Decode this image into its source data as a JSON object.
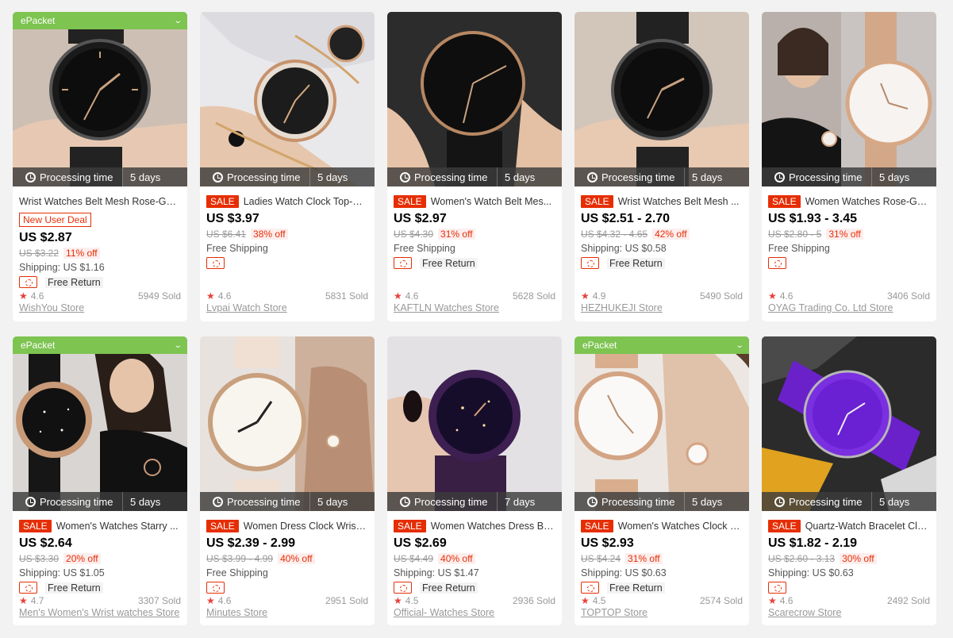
{
  "processing_label": "Processing time",
  "epacket_label": "ePacket",
  "free_return_label": "Free Return",
  "sale_label": "SALE",
  "colors": {
    "sale": "#e62e04",
    "epacket": "#7dc451",
    "star": "#e8403c"
  },
  "products": [
    {
      "epacket": true,
      "days": "5 days",
      "sale": false,
      "title": "Wrist Watches Belt Mesh Rose-Gol...",
      "new_user": "New User Deal",
      "price": "US $2.87",
      "orig": "US $3.22",
      "off": "11% off",
      "shipping": "Shipping: US $1.16",
      "free_return": true,
      "rating": "4.6",
      "sold": "5949 Sold",
      "store": "WishYou Store"
    },
    {
      "epacket": false,
      "days": "5 days",
      "sale": true,
      "title": "Ladies Watch Clock Top-St...",
      "price": "US $3.97",
      "orig": "US $6.41",
      "off": "38% off",
      "shipping": "Free Shipping",
      "free_return": false,
      "rating": "4.6",
      "sold": "5831 Sold",
      "store": "Lvpai Watch Store"
    },
    {
      "epacket": false,
      "days": "5 days",
      "sale": true,
      "title": "Women's Watch Belt Mes...",
      "price": "US $2.97",
      "orig": "US $4.30",
      "off": "31% off",
      "shipping": "Free Shipping",
      "free_return": true,
      "rating": "4.6",
      "sold": "5628 Sold",
      "store": "KAFTLN Watches Store"
    },
    {
      "epacket": false,
      "days": "5 days",
      "sale": true,
      "title": "Wrist Watches Belt Mesh ...",
      "price": "US $2.51 - 2.70",
      "orig": "US $4.32 - 4.65",
      "off": "42% off",
      "shipping": "Shipping: US $0.58",
      "free_return": true,
      "rating": "4.9",
      "sold": "5490 Sold",
      "store": "HEZHUKEJI Store"
    },
    {
      "epacket": false,
      "days": "5 days",
      "sale": true,
      "title": "Women Watches Rose-Gol...",
      "price": "US $1.93 - 3.45",
      "orig": "US $2.80 - 5",
      "off": "31% off",
      "shipping": "Free Shipping",
      "free_return": false,
      "rating": "4.6",
      "sold": "3406 Sold",
      "store": "OYAG Trading Co. Ltd Store"
    },
    {
      "epacket": true,
      "days": "5 days",
      "sale": true,
      "title": "Women's Watches Starry ...",
      "price": "US $2.64",
      "orig": "US $3.30",
      "off": "20% off",
      "shipping": "Shipping: US $1.05",
      "free_return": true,
      "rating": "4.7",
      "sold": "3307 Sold",
      "store": "Men's Women's Wrist watches Store"
    },
    {
      "epacket": false,
      "days": "5 days",
      "sale": true,
      "title": "Women Dress Clock Wrist-...",
      "price": "US $2.39 - 2.99",
      "orig": "US $3.99 - 4.99",
      "off": "40% off",
      "shipping": "Free Shipping",
      "free_return": false,
      "rating": "4.6",
      "sold": "2951 Sold",
      "store": "Minutes Store"
    },
    {
      "epacket": false,
      "days": "7 days",
      "sale": true,
      "title": "Women Watches Dress Be...",
      "price": "US $2.69",
      "orig": "US $4.49",
      "off": "40% off",
      "shipping": "Shipping: US $1.47",
      "free_return": true,
      "rating": "4.5",
      "sold": "2936 Sold",
      "store": "Official- Watches Store"
    },
    {
      "epacket": true,
      "days": "5 days",
      "sale": true,
      "title": "Women's Watches Clock Z...",
      "price": "US $2.93",
      "orig": "US $4.24",
      "off": "31% off",
      "shipping": "Shipping: US $0.63",
      "free_return": true,
      "rating": "4.5",
      "sold": "2574 Sold",
      "store": "TOPTOP Store"
    },
    {
      "epacket": false,
      "days": "5 days",
      "sale": true,
      "title": "Quartz-Watch Bracelet Clo...",
      "price": "US $1.82 - 2.19",
      "orig": "US $2.60 - 3.13",
      "off": "30% off",
      "shipping": "Shipping: US $0.63",
      "free_return": false,
      "rating": "4.6",
      "sold": "2492 Sold",
      "store": "Scarecrow Store"
    }
  ]
}
